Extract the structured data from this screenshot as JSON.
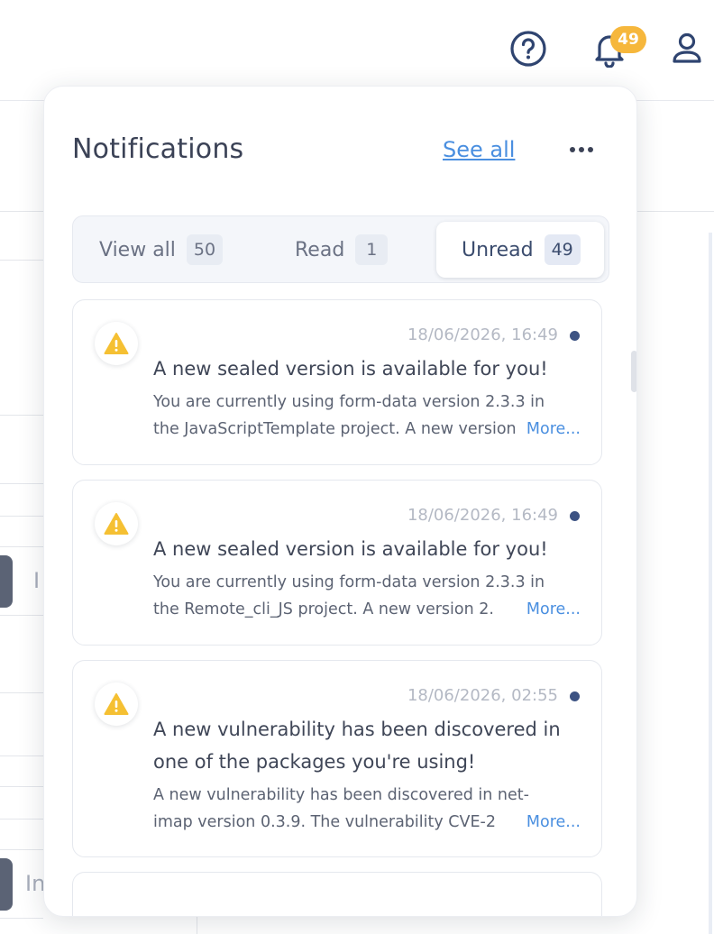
{
  "header": {
    "notification_badge": "49",
    "icons": [
      "help-circle-icon",
      "bell-icon",
      "user-icon"
    ],
    "badge_color": "#f6b73c"
  },
  "background": {
    "partial_text_1": "I",
    "partial_text_2": "In"
  },
  "notifications": {
    "title": "Notifications",
    "see_all": "See all",
    "tabs": [
      {
        "label": "View all",
        "count": "50"
      },
      {
        "label": "Read",
        "count": "1"
      },
      {
        "label": "Unread",
        "count": "49",
        "active": true
      }
    ],
    "items": [
      {
        "icon": "warning-icon",
        "timestamp": "18/06/2026, 16:49",
        "title": "A new sealed version is available for you!",
        "body_line1": "You are currently using form-data version 2.3.3 in",
        "body_line2": "the JavaScriptTemplate project. A new version",
        "more": "More..."
      },
      {
        "icon": "warning-icon",
        "timestamp": "18/06/2026, 16:49",
        "title": "A new sealed version is available for you!",
        "body_line1": "You are currently using form-data version 2.3.3 in",
        "body_line2": "the Remote_cli_JS project. A new version 2.",
        "more": "More..."
      },
      {
        "icon": "warning-icon",
        "timestamp": "18/06/2026, 02:55",
        "title_line1": "A new vulnerability has been discovered in",
        "title_line2": "one of the packages you're using!",
        "body_line1": "A new vulnerability has been discovered in net-",
        "body_line2": "imap version 0.3.9. The vulnerability CVE-2",
        "more": "More..."
      }
    ],
    "colors": {
      "accent": "#4a8fe0",
      "unread_dot": "#3d5383",
      "warning": "#f5c033"
    }
  }
}
